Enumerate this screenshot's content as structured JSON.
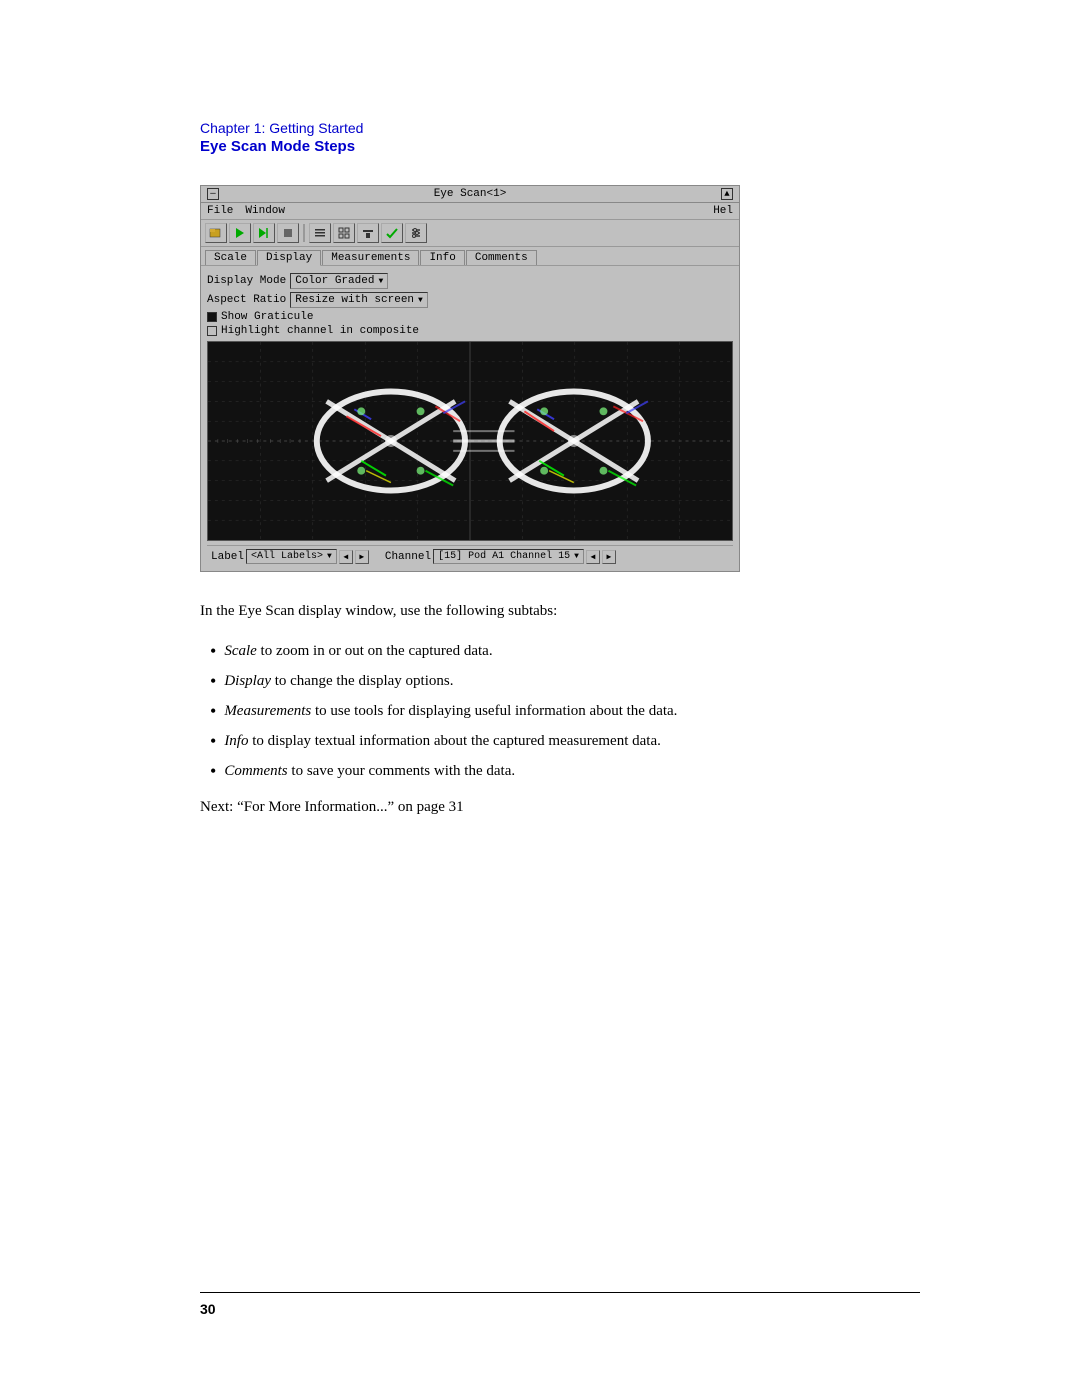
{
  "breadcrumb": {
    "chapter": "Chapter 1: Getting Started",
    "section": "Eye Scan Mode Steps"
  },
  "window": {
    "title": "Eye Scan<1>",
    "menu_items": [
      "File",
      "Window"
    ],
    "menu_right": "Hel",
    "tabs": [
      "Scale",
      "Display",
      "Measurements",
      "Info",
      "Comments"
    ],
    "display_mode_label": "Display Mode",
    "display_mode_value": "Color Graded",
    "aspect_ratio_label": "Aspect Ratio",
    "aspect_ratio_value": "Resize with screen",
    "show_graticule_label": "Show Graticule",
    "show_graticule_checked": true,
    "highlight_label": "Highlight channel in composite",
    "highlight_checked": false,
    "bottom_label_text": "Label",
    "bottom_label_value": "<All Labels>",
    "bottom_channel_text": "Channel",
    "bottom_channel_value": "[15] Pod A1 Channel 15"
  },
  "body": {
    "intro": "In the Eye Scan display window, use the following subtabs:",
    "bullets": [
      {
        "italic": "Scale",
        "rest": " to zoom in or out on the captured data."
      },
      {
        "italic": "Display",
        "rest": " to change the display options."
      },
      {
        "italic": "Measurements",
        "rest": " to use tools for displaying useful information about the data."
      },
      {
        "italic": "Info",
        "rest": " to display textual information about the captured measurement data."
      },
      {
        "italic": "Comments",
        "rest": " to save your comments with the data."
      }
    ],
    "next_text": "Next: “For More Information...” on page 31"
  },
  "footer": {
    "page_number": "30"
  }
}
